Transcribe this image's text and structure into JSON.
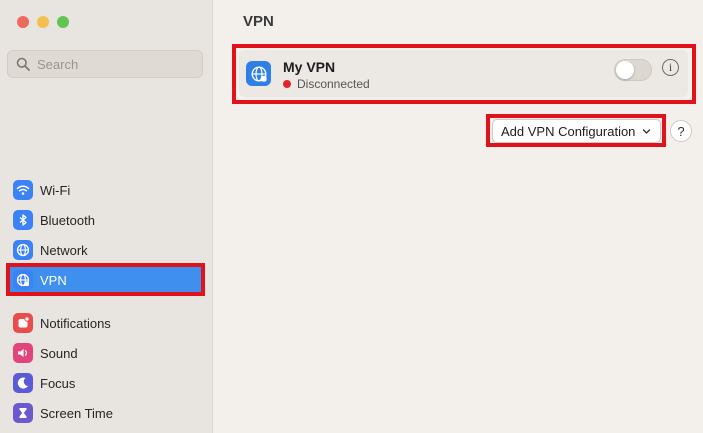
{
  "window": {
    "traffic_lights": [
      {
        "name": "close",
        "color": "#ed6a5e"
      },
      {
        "name": "minimize",
        "color": "#f5bf4f"
      },
      {
        "name": "zoom",
        "color": "#61c554"
      }
    ]
  },
  "search": {
    "placeholder": "Search",
    "value": ""
  },
  "sidebar": {
    "items": [
      {
        "label": "Wi-Fi",
        "icon": "wifi-icon",
        "color": "#3b82f6",
        "active": false
      },
      {
        "label": "Bluetooth",
        "icon": "bluetooth-icon",
        "color": "#3b82f6",
        "active": false
      },
      {
        "label": "Network",
        "icon": "globe-icon",
        "color": "#3b82f6",
        "active": false
      },
      {
        "label": "VPN",
        "icon": "vpn-globe-icon",
        "color": "#3b82f6",
        "active": true
      },
      {
        "label": "Notifications",
        "icon": "notifications-icon",
        "color": "#ea4b4b",
        "active": false
      },
      {
        "label": "Sound",
        "icon": "speaker-icon",
        "color": "#e0457b",
        "active": false
      },
      {
        "label": "Focus",
        "icon": "moon-icon",
        "color": "#5b5bd6",
        "active": false
      },
      {
        "label": "Screen Time",
        "icon": "hourglass-icon",
        "color": "#6a5acd",
        "active": false
      }
    ]
  },
  "main": {
    "title": "VPN",
    "vpn": {
      "name": "My VPN",
      "status": "Disconnected",
      "status_color": "#e0262c",
      "enabled": false,
      "info_glyph": "i"
    },
    "add_button": {
      "label": "Add VPN Configuration"
    },
    "help_glyph": "?"
  },
  "highlight_color": "#e0121c",
  "accent_color": "#3f8fef"
}
